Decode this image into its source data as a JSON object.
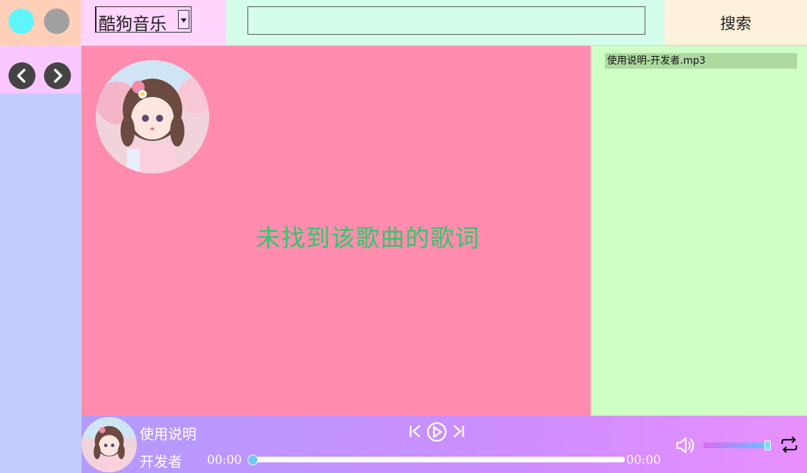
{
  "source": {
    "selected": "酷狗音乐"
  },
  "search": {
    "value": "",
    "button_label": "搜索"
  },
  "lyrics": {
    "message": "未找到该歌曲的歌词"
  },
  "playlist": {
    "items": [
      "使用说明-开发者.mp3"
    ]
  },
  "player": {
    "title": "使用说明",
    "artist": "开发者",
    "current_time": "00:00",
    "total_time": "00:00",
    "progress": 0,
    "volume": 1.0
  },
  "icons": {
    "close": "circle-cyan",
    "minimize": "circle-gray",
    "back": "chevron-left-icon",
    "forward": "chevron-right-icon",
    "prev": "skip-previous-icon",
    "play": "play-icon",
    "next": "skip-next-icon",
    "volume": "volume-icon",
    "loop": "repeat-icon"
  },
  "colors": {
    "lyrics_bg": "#ff8cae",
    "lyrics_text": "#2fc86a",
    "playlist_bg": "#cfffc4",
    "playlist_selected": "#aed9a1"
  }
}
